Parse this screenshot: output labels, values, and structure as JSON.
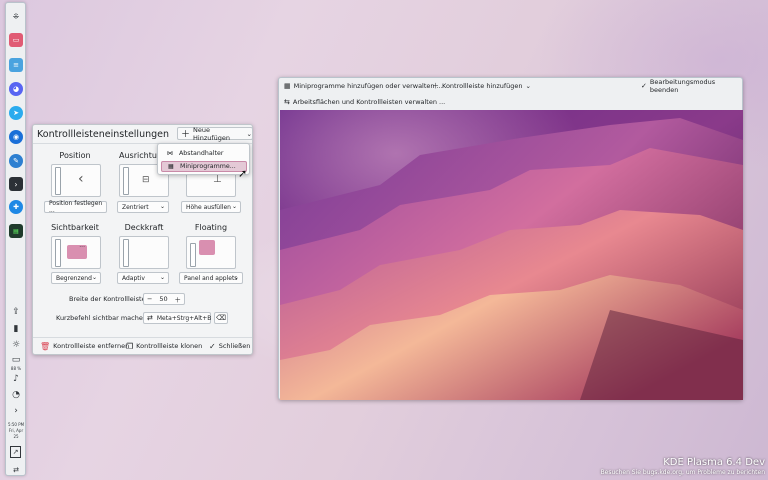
{
  "editor_toolbar": {
    "add_widgets": "Miniprogramme hinzufügen oder verwalten ...",
    "add_panel": "Kontrollleiste hinzufügen",
    "exit_edit": "Bearbeitungsmodus beenden",
    "manage_desktops": "Arbeitsflächen und Kontrollleisten verwalten ..."
  },
  "panel_settings": {
    "title": "Kontrollleisteneinstellungen",
    "add_new": "Neue Hinzufügen",
    "position": {
      "label": "Position",
      "value": "Position festlegen ..."
    },
    "alignment": {
      "label": "Ausrichtung",
      "value": "Zentriert"
    },
    "height": {
      "value": "Höhe ausfüllen"
    },
    "visibility": {
      "label": "Sichtbarkeit",
      "value": "Begrenzend"
    },
    "opacity": {
      "label": "Deckkraft",
      "value": "Adaptiv"
    },
    "floating": {
      "label": "Floating",
      "value": "Panel and applets"
    },
    "width": {
      "label": "Breite der Kontrollleiste:",
      "value": "50"
    },
    "shortcut": {
      "label": "Kurzbefehl sichtbar machen:",
      "value": "Meta+Strg+Alt+B"
    },
    "remove": "Kontrollleiste entfernen",
    "clone": "Kontrollleiste klonen",
    "close": "Schließen"
  },
  "add_menu": {
    "items": [
      "Abstandhalter",
      "Miniprogramme..."
    ]
  },
  "tray": {
    "battery": "88 %",
    "time": "5:50 PM",
    "date_line1": "Fri, Apr",
    "date_line2": "25"
  },
  "watermark": {
    "title": "KDE Plasma 6.4 Dev",
    "subtitle": "Besuchen Sie bugs.kde.org, um Probleme zu berichten"
  },
  "colors": {
    "accent": "#3daee9",
    "menu_highlight": "#e4c9d6",
    "preview": "#d98fb0"
  }
}
